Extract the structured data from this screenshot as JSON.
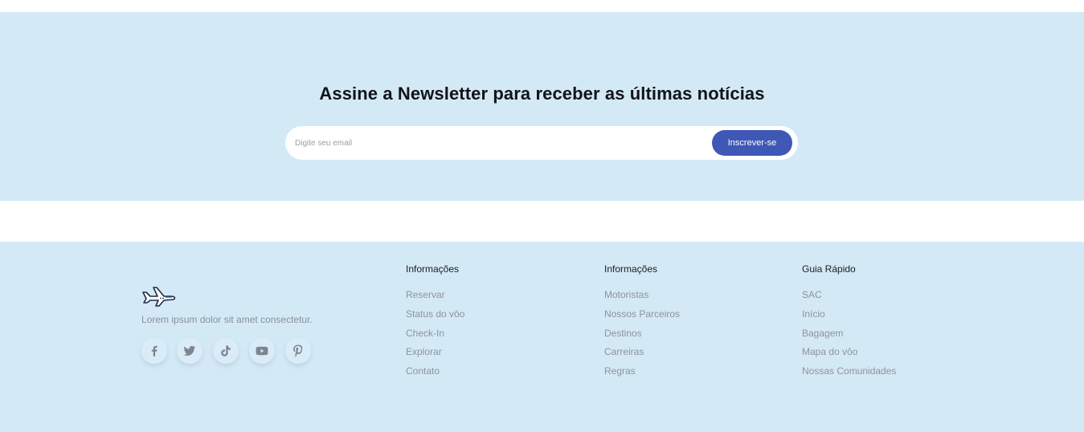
{
  "newsletter": {
    "title": "Assine a Newsletter para receber as últimas notícias",
    "placeholder": "Digite seu email",
    "button": "Inscrever-se"
  },
  "footer": {
    "brand_text": "Lorem ipsum dolor sit amet consectetur.",
    "socials": [
      "facebook-icon",
      "twitter-icon",
      "tiktok-icon",
      "youtube-icon",
      "pinterest-icon"
    ],
    "columns": [
      {
        "title": "Informações",
        "links": [
          "Reservar",
          "Status do vôo",
          "Check-In",
          "Explorar",
          "Contato"
        ]
      },
      {
        "title": "Informações",
        "links": [
          "Motoristas",
          "Nossos Parceiros",
          "Destinos",
          "Carreiras",
          "Regras"
        ]
      },
      {
        "title": "Guia Rápido",
        "links": [
          "SAC",
          "Início",
          "Bagagem",
          "Mapa do vôo",
          "Nossas Comunidades"
        ]
      }
    ]
  },
  "colors": {
    "section_bg": "#d4e9f6",
    "button_bg": "#3f58b6",
    "heading": "#111418",
    "link": "#8e939a"
  }
}
